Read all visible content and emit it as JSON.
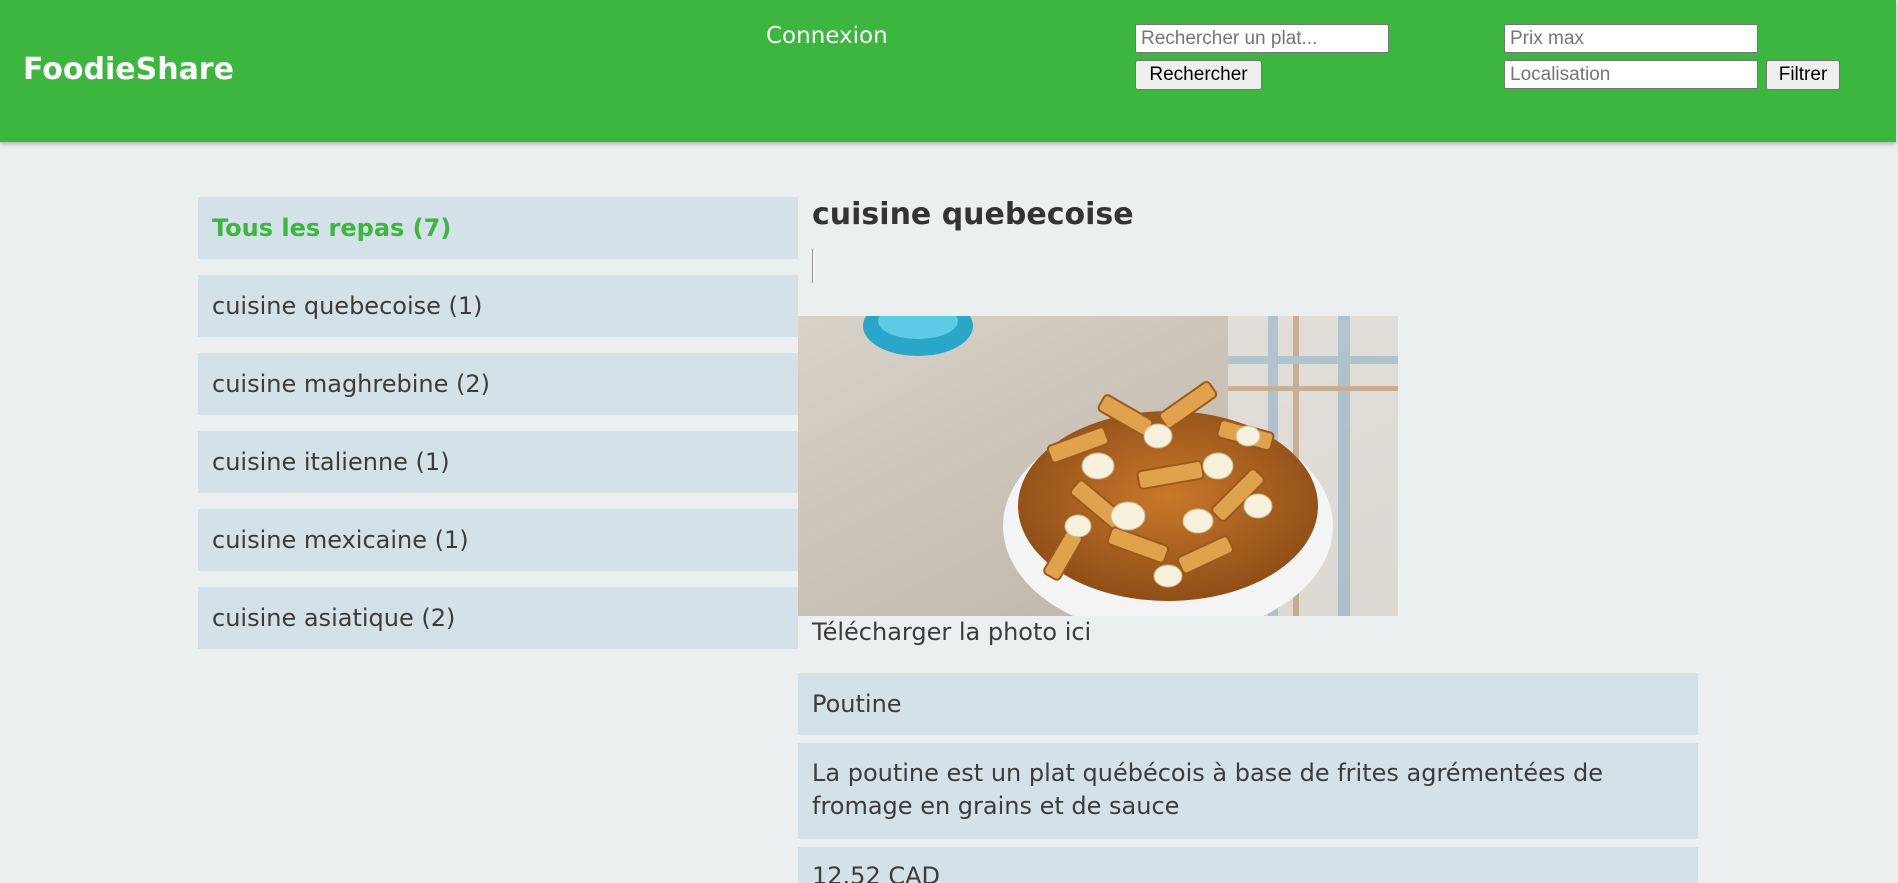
{
  "header": {
    "brand": "FoodieShare",
    "login_label": "Connexion",
    "search_placeholder": "Rechercher un plat...",
    "search_button": "Rechercher",
    "price_placeholder": "Prix max",
    "location_placeholder": "Localisation",
    "filter_button": "Filtrer"
  },
  "categories": [
    {
      "label": "Tous les repas (7)",
      "active": true
    },
    {
      "label": "cuisine quebecoise (1)"
    },
    {
      "label": "cuisine maghrebine (2)"
    },
    {
      "label": "cuisine italienne (1)"
    },
    {
      "label": "cuisine mexicaine (1)"
    },
    {
      "label": "cuisine asiatique (2)"
    }
  ],
  "detail": {
    "category_title": "cuisine quebecoise",
    "upload_label": "Télécharger la photo ici",
    "dish_name": "Poutine",
    "description": "La poutine est un plat québécois à base de frites agrémentées de fromage en grains et de sauce",
    "price": "12.52 CAD"
  }
}
